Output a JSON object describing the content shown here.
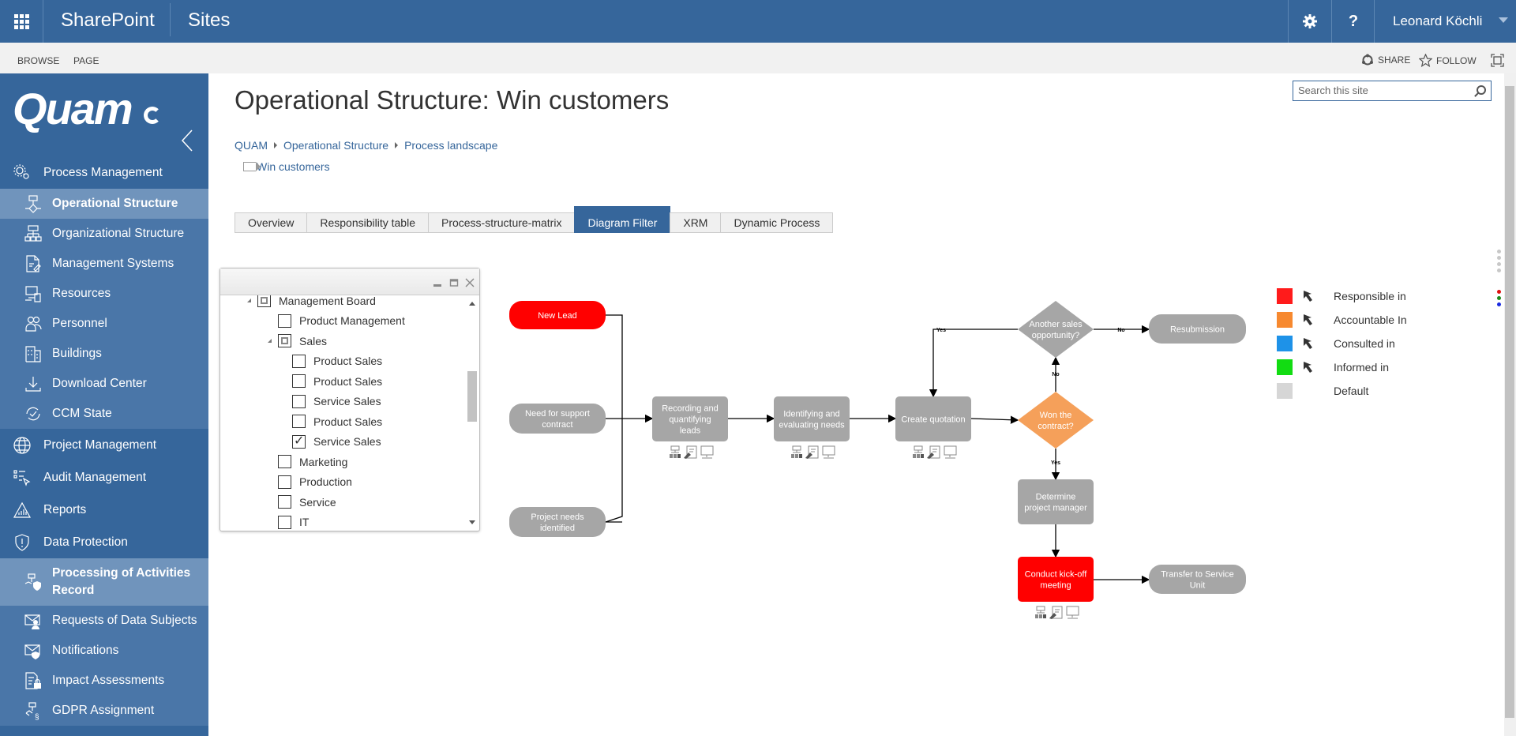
{
  "topbar": {
    "brand": "SharePoint",
    "sites": "Sites",
    "settings_icon": "gear-icon",
    "help_label": "?",
    "user_name": "Leonard Köchli"
  },
  "ribbon": {
    "tabs": [
      "BROWSE",
      "PAGE"
    ],
    "share": "SHARE",
    "follow": "FOLLOW"
  },
  "sidebar": {
    "logo": "Quam",
    "items": [
      {
        "label": "Process Management",
        "level": 1,
        "icon": "gears-icon"
      },
      {
        "label": "Operational Structure",
        "level": 2,
        "icon": "flowchart-icon",
        "active": true
      },
      {
        "label": "Organizational Structure",
        "level": 2,
        "icon": "org-chart-icon"
      },
      {
        "label": "Management Systems",
        "level": 2,
        "icon": "document-edit-icon"
      },
      {
        "label": "Resources",
        "level": 2,
        "icon": "resources-icon"
      },
      {
        "label": "Personnel",
        "level": 2,
        "icon": "people-icon"
      },
      {
        "label": "Buildings",
        "level": 2,
        "icon": "building-icon"
      },
      {
        "label": "Download Center",
        "level": 2,
        "icon": "download-icon"
      },
      {
        "label": "CCM State",
        "level": 2,
        "icon": "refresh-check-icon"
      },
      {
        "label": "Project Management",
        "level": 1,
        "icon": "globe-icon"
      },
      {
        "label": "Audit Management",
        "level": 1,
        "icon": "checklist-cursor-icon"
      },
      {
        "label": "Reports",
        "level": 1,
        "icon": "chart-triangle-icon"
      },
      {
        "label": "Data Protection",
        "level": 1,
        "icon": "shield-icon"
      },
      {
        "label": "Processing of Activities Record",
        "level": 2,
        "icon": "flow-shield-icon",
        "active": true
      },
      {
        "label": "Requests of Data Subjects",
        "level": 2,
        "icon": "mail-person-icon"
      },
      {
        "label": "Notifications",
        "level": 2,
        "icon": "mail-shield-icon"
      },
      {
        "label": "Impact Assessments",
        "level": 2,
        "icon": "document-lock-icon"
      },
      {
        "label": "GDPR Assignment",
        "level": 2,
        "icon": "flow-paragraph-icon"
      }
    ]
  },
  "page": {
    "title": "Operational Structure: Win customers",
    "breadcrumb": [
      "QUAM",
      "Operational Structure",
      "Process landscape"
    ],
    "current": "Win customers",
    "search_placeholder": "Search this site"
  },
  "tabs": [
    {
      "label": "Overview"
    },
    {
      "label": "Responsibility table"
    },
    {
      "label": "Process-structure-matrix"
    },
    {
      "label": "Diagram Filter",
      "active": true
    },
    {
      "label": "XRM"
    },
    {
      "label": "Dynamic Process"
    }
  ],
  "filter_tree": [
    {
      "label": "Management Board",
      "indent": 0,
      "state": "partial",
      "expanded": true
    },
    {
      "label": "Product Management",
      "indent": 1,
      "state": "unchecked"
    },
    {
      "label": "Sales",
      "indent": 1,
      "state": "partial",
      "expanded": true
    },
    {
      "label": "Product Sales",
      "indent": 2,
      "state": "unchecked"
    },
    {
      "label": "Product Sales",
      "indent": 2,
      "state": "unchecked"
    },
    {
      "label": "Service Sales",
      "indent": 2,
      "state": "unchecked"
    },
    {
      "label": "Product Sales",
      "indent": 2,
      "state": "unchecked"
    },
    {
      "label": "Service Sales",
      "indent": 2,
      "state": "checked"
    },
    {
      "label": "Marketing",
      "indent": 1,
      "state": "unchecked"
    },
    {
      "label": "Production",
      "indent": 1,
      "state": "unchecked"
    },
    {
      "label": "Service",
      "indent": 1,
      "state": "unchecked"
    },
    {
      "label": "IT",
      "indent": 1,
      "state": "unchecked"
    }
  ],
  "diagram": {
    "nodes": {
      "new_lead": {
        "label": "New Lead",
        "kind": "event",
        "role": "responsible"
      },
      "support": {
        "label": "Need for support contract",
        "kind": "event",
        "role": "default"
      },
      "project_needs": {
        "label": "Project needs identified",
        "kind": "event",
        "role": "default"
      },
      "recording": {
        "label": "Recording and quantifying leads",
        "kind": "task",
        "role": "default"
      },
      "identifying": {
        "label": "Identifying and evaluating needs",
        "kind": "task",
        "role": "default"
      },
      "quotation": {
        "label": "Create quotation",
        "kind": "task",
        "role": "default"
      },
      "won": {
        "label": "Won the contract?",
        "kind": "decision",
        "role": "accountable"
      },
      "another": {
        "label": "Another sales opportunity?",
        "kind": "decision",
        "role": "default"
      },
      "resubmission": {
        "label": "Resubmission",
        "kind": "event",
        "role": "default"
      },
      "determine_pm": {
        "label": "Determine project manager",
        "kind": "task",
        "role": "default"
      },
      "kickoff": {
        "label": "Conduct kick-off meeting",
        "kind": "task",
        "role": "responsible"
      },
      "transfer": {
        "label": "Transfer to Service Unit",
        "kind": "event",
        "role": "default"
      }
    },
    "edge_labels": {
      "yes": "Yes",
      "no": "No"
    }
  },
  "legend": [
    {
      "label": "Responsible in",
      "color": "#ff1b1b",
      "cursor": true
    },
    {
      "label": "Accountable In",
      "color": "#f7892f",
      "cursor": true
    },
    {
      "label": "Consulted in",
      "color": "#1e92e8",
      "cursor": true
    },
    {
      "label": "Informed in",
      "color": "#12dc12",
      "cursor": true
    },
    {
      "label": "Default",
      "color": "#d6d6d6",
      "cursor": false
    }
  ],
  "colors": {
    "brand": "#36669b",
    "responsible": "#ff0000",
    "accountable": "#f5a05a",
    "default_node": "#a6a6a6"
  }
}
